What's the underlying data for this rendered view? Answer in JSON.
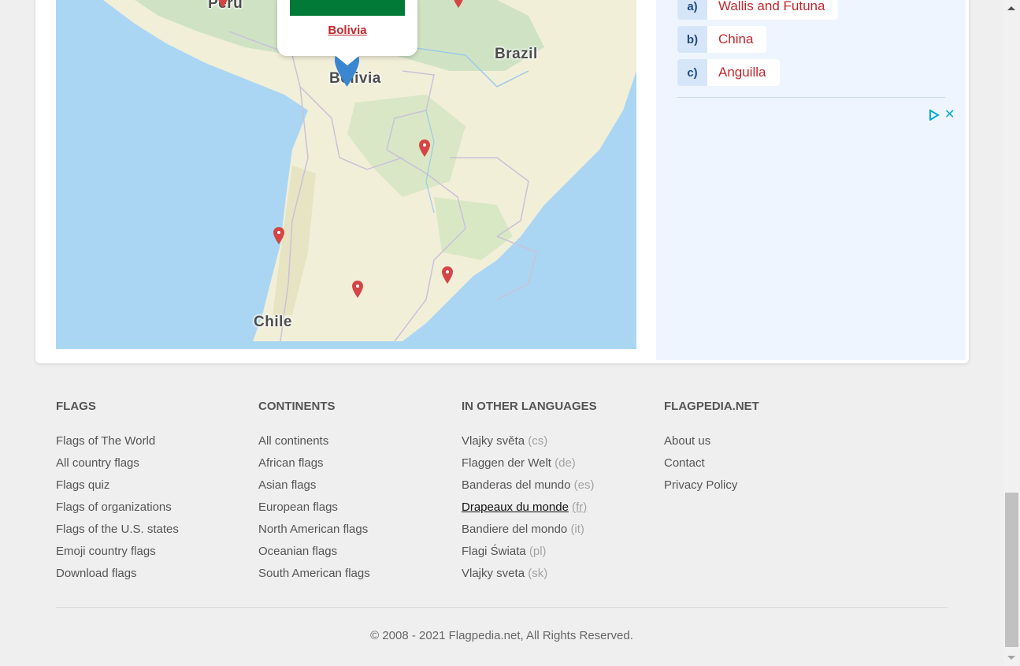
{
  "map": {
    "labels": {
      "peru": "Peru",
      "brazil": "Brazil",
      "bolivia": "Bolivia",
      "chile": "Chile"
    },
    "popup": {
      "country_link": "Bolivia",
      "flag_color": "#007a36"
    },
    "pin_color": "#d64545",
    "selected_pin_color": "#3a86d0"
  },
  "quiz": {
    "answers": [
      {
        "letter": "a)",
        "text": "Wallis and Futuna"
      },
      {
        "letter": "b)",
        "text": "China"
      },
      {
        "letter": "c)",
        "text": "Anguilla"
      }
    ],
    "ad_icons": [
      "adchoices-icon",
      "close-icon"
    ]
  },
  "footer": {
    "flags": {
      "heading": "FLAGS",
      "links": [
        "Flags of The World",
        "All country flags",
        "Flags quiz",
        "Flags of organizations",
        "Flags of the U.S. states",
        "Emoji country flags",
        "Download flags"
      ]
    },
    "continents": {
      "heading": "CONTINENTS",
      "links": [
        "All continents",
        "African flags",
        "Asian flags",
        "European flags",
        "North American flags",
        "Oceanian flags",
        "South American flags"
      ]
    },
    "languages": {
      "heading": "IN OTHER LANGUAGES",
      "links": [
        {
          "label": "Vlajky světa",
          "code": "(cs)"
        },
        {
          "label": "Flaggen der Welt",
          "code": "(de)"
        },
        {
          "label": "Banderas del mundo",
          "code": "(es)"
        },
        {
          "label": "Drapeaux du monde",
          "code": "(fr)"
        },
        {
          "label": "Bandiere del mondo",
          "code": "(it)"
        },
        {
          "label": "Flagi Świata",
          "code": "(pl)"
        },
        {
          "label": "Vlajky sveta",
          "code": "(sk)"
        }
      ]
    },
    "site": {
      "heading": "FLAGPEDIA.NET",
      "links": [
        "About us",
        "Contact",
        "Privacy Policy"
      ]
    },
    "copyright": "© 2008 - 2021 Flagpedia.net, All Rights Reserved."
  }
}
